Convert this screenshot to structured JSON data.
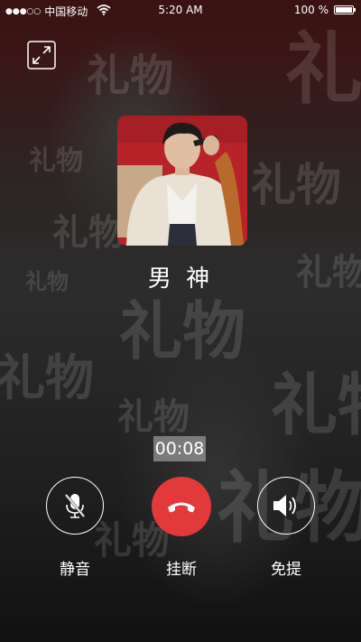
{
  "status_bar": {
    "signal": "●●●○○",
    "carrier": "中国移动",
    "time": "5:20 AM",
    "battery": "100 %",
    "battery_level": 1.0
  },
  "watermark_text": "礼物",
  "caller": {
    "name": "男 神"
  },
  "call": {
    "duration": "00:08"
  },
  "controls": {
    "mute_label": "静音",
    "hangup_label": "挂断",
    "speaker_label": "免提"
  },
  "colors": {
    "hangup": "#e23a3a",
    "avatar_bg": "#b8232a"
  }
}
